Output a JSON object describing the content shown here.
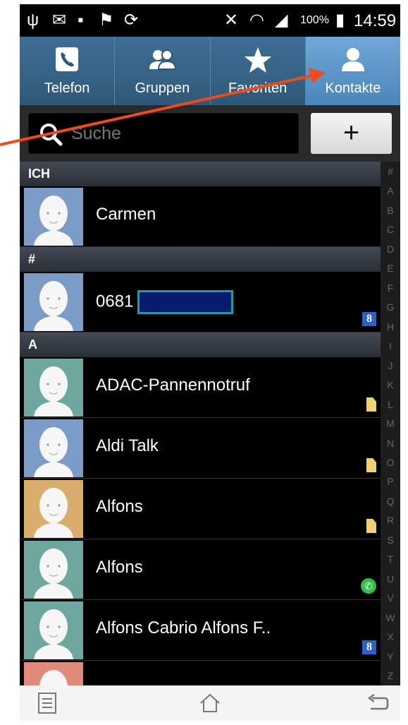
{
  "status_bar": {
    "battery_percent": "100%",
    "time": "14:59"
  },
  "tabs": [
    {
      "label": "Telefon",
      "icon": "phone-icon",
      "active": false
    },
    {
      "label": "Gruppen",
      "icon": "group-icon",
      "active": false
    },
    {
      "label": "Favoriten",
      "icon": "star-icon",
      "active": false
    },
    {
      "label": "Kontakte",
      "icon": "contact-icon",
      "active": true
    }
  ],
  "search": {
    "placeholder": "Suche",
    "add_label": "+"
  },
  "sections": [
    {
      "header": "ICH",
      "contacts": [
        {
          "name": "Carmen",
          "avatar_color": "#7c9cc8",
          "badge": ""
        }
      ]
    },
    {
      "header": "#",
      "contacts": [
        {
          "name": "0681",
          "avatar_color": "#7c9cc8",
          "badge": "google",
          "redacted": true
        }
      ]
    },
    {
      "header": "A",
      "contacts": [
        {
          "name": "ADAC-Pannennotruf",
          "avatar_color": "#6ea6a0",
          "badge": "sim"
        },
        {
          "name": "Aldi Talk",
          "avatar_color": "#7c9cc8",
          "badge": "sim"
        },
        {
          "name": "Alfons",
          "avatar_color": "#d9ad6c",
          "badge": "sim"
        },
        {
          "name": "Alfons",
          "avatar_color": "#6ea6a0",
          "badge": "whatsapp"
        },
        {
          "name": "Alfons Cabrio Alfons F..",
          "avatar_color": "#6ea6a0",
          "badge": "google"
        }
      ]
    }
  ],
  "alphabet_index": [
    "#",
    "A",
    "B",
    "C",
    "D",
    "E",
    "F",
    "G",
    "H",
    "I",
    "J",
    "K",
    "L",
    "M",
    "N",
    "O",
    "P",
    "Q",
    "R",
    "S",
    "T",
    "U",
    "V",
    "W",
    "X",
    "Y",
    "Z"
  ],
  "colors": {
    "tab_bar": "#3e6f95",
    "tab_active": "#5e97c8",
    "annotation_arrow": "#f04a1a"
  }
}
